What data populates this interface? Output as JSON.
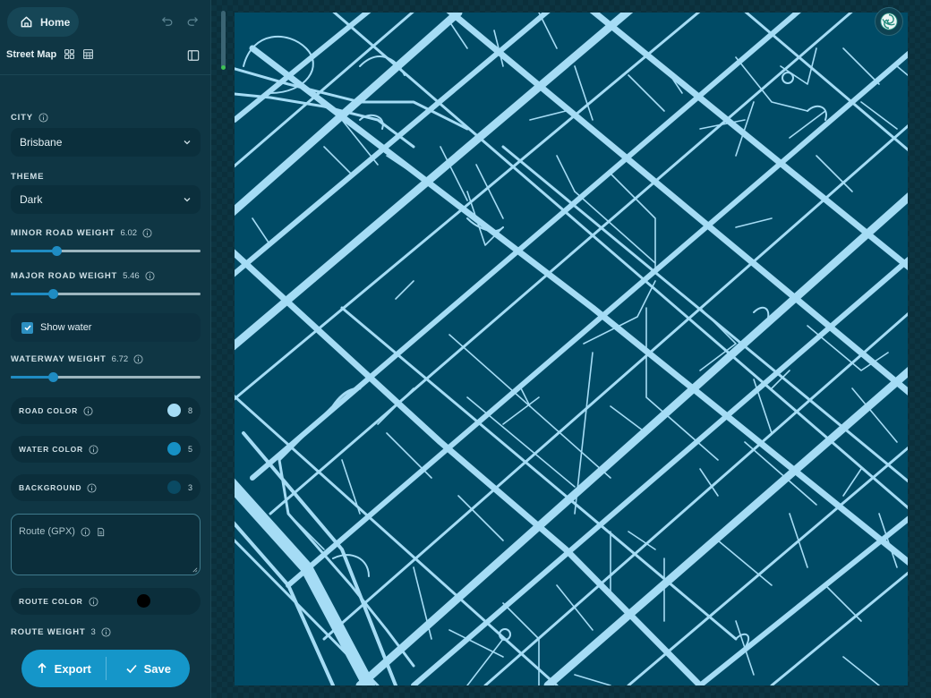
{
  "header": {
    "home_label": "Home",
    "map_title": "Street Map"
  },
  "controls": {
    "city": {
      "label": "CITY",
      "value": "Brisbane"
    },
    "theme": {
      "label": "THEME",
      "value": "Dark"
    },
    "minor_road_weight": {
      "label": "MINOR ROAD WEIGHT",
      "value": "6.02",
      "fraction": 0.24
    },
    "major_road_weight": {
      "label": "MAJOR ROAD WEIGHT",
      "value": "5.46",
      "fraction": 0.22
    },
    "show_water": {
      "label": "Show water",
      "checked": true
    },
    "waterway_weight": {
      "label": "WATERWAY WEIGHT",
      "value": "6.72",
      "fraction": 0.22
    },
    "road_color": {
      "label": "ROAD COLOR",
      "count": "8",
      "color": "#a5dcf5"
    },
    "water_color": {
      "label": "WATER COLOR",
      "count": "5",
      "color": "#1690c4"
    },
    "background": {
      "label": "BACKGROUND",
      "count": "3",
      "color": "#0a4a63"
    },
    "route": {
      "placeholder": "Route (GPX)"
    },
    "route_color": {
      "label": "ROUTE COLOR",
      "color": "#000000"
    },
    "route_weight": {
      "label": "ROUTE WEIGHT",
      "value": "3"
    }
  },
  "actions": {
    "export_label": "Export",
    "save_label": "Save"
  },
  "colors": {
    "accent": "#1596c9",
    "map_background": "#004b66",
    "road": "#a5dcf5"
  },
  "icons": [
    "home-icon",
    "undo-icon",
    "redo-icon",
    "grid-icon",
    "table-icon",
    "panel-icon",
    "info-icon",
    "chevron-down-icon",
    "check-icon",
    "file-icon",
    "export-icon",
    "save-check-icon",
    "spiral-logo-icon"
  ]
}
